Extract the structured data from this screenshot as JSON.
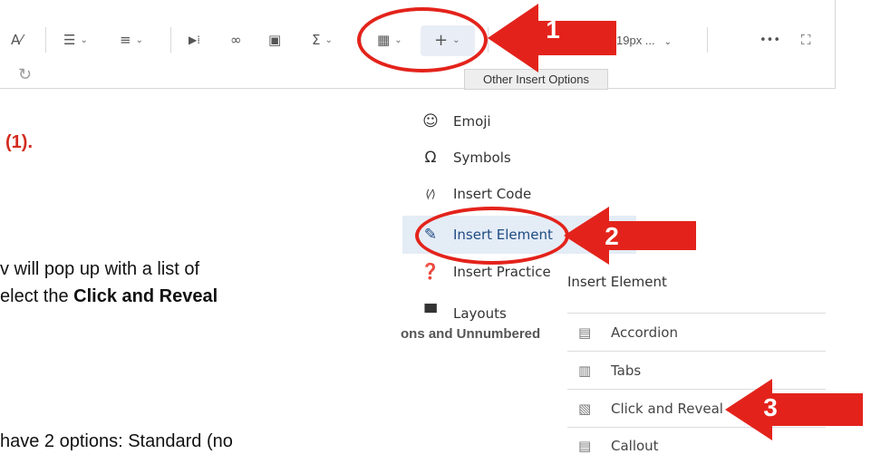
{
  "toolbar": {
    "items": [
      {
        "name": "text-direction-icon",
        "glyph": "A⁄",
        "chevron": false
      },
      {
        "name": "align-icon",
        "glyph": "☰",
        "chevron": true
      },
      {
        "name": "list-icon",
        "glyph": "≡",
        "chevron": true
      },
      {
        "name": "media-icon",
        "glyph": "▶⁞",
        "chevron": false
      },
      {
        "name": "link-icon",
        "glyph": "∞",
        "chevron": false
      },
      {
        "name": "image-icon",
        "glyph": "▣",
        "chevron": false
      },
      {
        "name": "equation-icon",
        "glyph": "Σ",
        "chevron": true
      },
      {
        "name": "table-icon",
        "glyph": "▦",
        "chevron": true
      }
    ],
    "plus_label": "+",
    "plus_chevron": "⌄",
    "font_size_value": "19px ...",
    "font_size_chevron": "⌄",
    "more_label": "•••",
    "fullscreen_label": "⛶",
    "redo_label": "↻",
    "tooltip": "Other Insert Options"
  },
  "callouts": {
    "one": "1",
    "two": "2",
    "three": "3"
  },
  "document": {
    "line1_suffix": "(1).",
    "line2": "v will pop up with a list of",
    "line3_prefix": "elect the ",
    "line3_bold": "Click and Reveal",
    "line4": "have 2 options: Standard (no"
  },
  "insert_menu": {
    "items": [
      {
        "label": "Emoji",
        "icon": "☺"
      },
      {
        "label": "Symbols",
        "icon": "Ω"
      },
      {
        "label": "Insert Code",
        "icon": "⟨⁄⟩"
      },
      {
        "label": "Insert Element",
        "icon": "✎"
      },
      {
        "label": "Insert Practice",
        "icon": "❓"
      },
      {
        "label": "Layouts",
        "icon": "▀"
      }
    ],
    "hidden_text": "ons and Unnumbered"
  },
  "element_panel": {
    "title": "Insert Element",
    "items": [
      {
        "label": "Accordion",
        "icon": "▤"
      },
      {
        "label": "Tabs",
        "icon": "▥"
      },
      {
        "label": "Click and Reveal",
        "icon": "▧"
      },
      {
        "label": "Callout",
        "icon": "▤"
      }
    ]
  },
  "colors": {
    "annotation_red": "#e3231b",
    "active_bg": "#e4ecf6",
    "active_text": "#1f4b83"
  }
}
